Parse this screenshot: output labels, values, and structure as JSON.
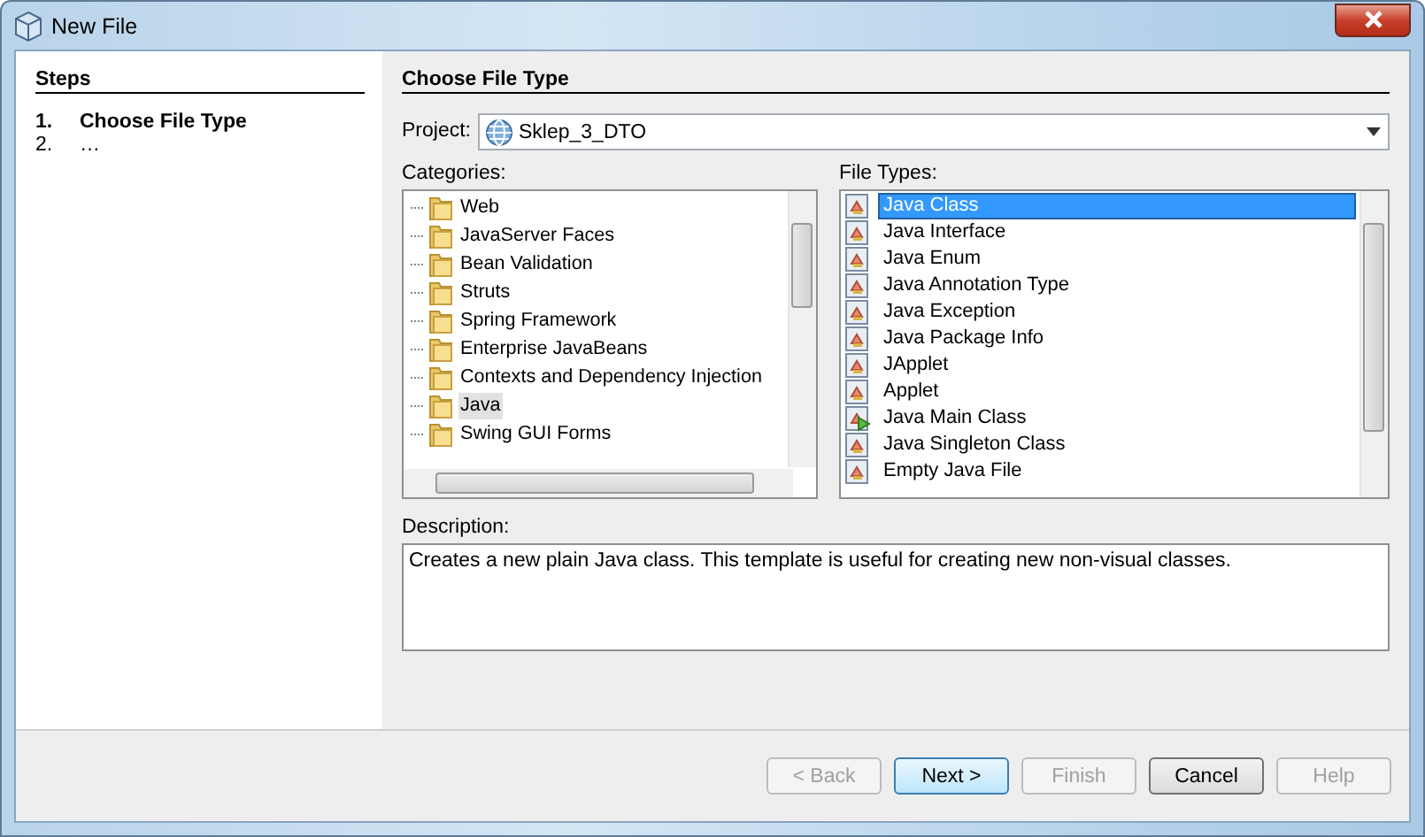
{
  "window": {
    "title": "New File"
  },
  "steps": {
    "heading": "Steps",
    "items": [
      {
        "number": "1.",
        "label": "Choose File Type",
        "selected": true
      },
      {
        "number": "2.",
        "label": "…",
        "selected": false
      }
    ]
  },
  "panel": {
    "heading": "Choose File Type"
  },
  "project": {
    "label": "Project:",
    "value": "Sklep_3_DTO"
  },
  "categories": {
    "label": "Categories:",
    "items": [
      {
        "label": "Web",
        "selected": false
      },
      {
        "label": "JavaServer Faces",
        "selected": false
      },
      {
        "label": "Bean Validation",
        "selected": false
      },
      {
        "label": "Struts",
        "selected": false
      },
      {
        "label": "Spring Framework",
        "selected": false
      },
      {
        "label": "Enterprise JavaBeans",
        "selected": false
      },
      {
        "label": "Contexts and Dependency Injection",
        "selected": false
      },
      {
        "label": "Java",
        "selected": true
      },
      {
        "label": "Swing GUI Forms",
        "selected": false
      }
    ]
  },
  "file_types": {
    "label": "File Types:",
    "items": [
      {
        "label": "Java Class",
        "kind": "class",
        "selected": true
      },
      {
        "label": "Java Interface",
        "kind": "class",
        "selected": false
      },
      {
        "label": "Java Enum",
        "kind": "class",
        "selected": false
      },
      {
        "label": "Java Annotation Type",
        "kind": "class",
        "selected": false
      },
      {
        "label": "Java Exception",
        "kind": "class",
        "selected": false
      },
      {
        "label": "Java Package Info",
        "kind": "class",
        "selected": false
      },
      {
        "label": "JApplet",
        "kind": "class",
        "selected": false
      },
      {
        "label": "Applet",
        "kind": "class",
        "selected": false
      },
      {
        "label": "Java Main Class",
        "kind": "main",
        "selected": false
      },
      {
        "label": "Java Singleton Class",
        "kind": "class",
        "selected": false
      },
      {
        "label": "Empty Java File",
        "kind": "class",
        "selected": false
      }
    ]
  },
  "description": {
    "label": "Description:",
    "text": "Creates a new plain Java class. This template is useful for creating new non-visual classes."
  },
  "buttons": [
    {
      "label": "< Back",
      "disabled": true,
      "default": false
    },
    {
      "label": "Next >",
      "disabled": false,
      "default": true
    },
    {
      "label": "Finish",
      "disabled": true,
      "default": false
    },
    {
      "label": "Cancel",
      "disabled": false,
      "default": false
    },
    {
      "label": "Help",
      "disabled": true,
      "default": false
    }
  ]
}
